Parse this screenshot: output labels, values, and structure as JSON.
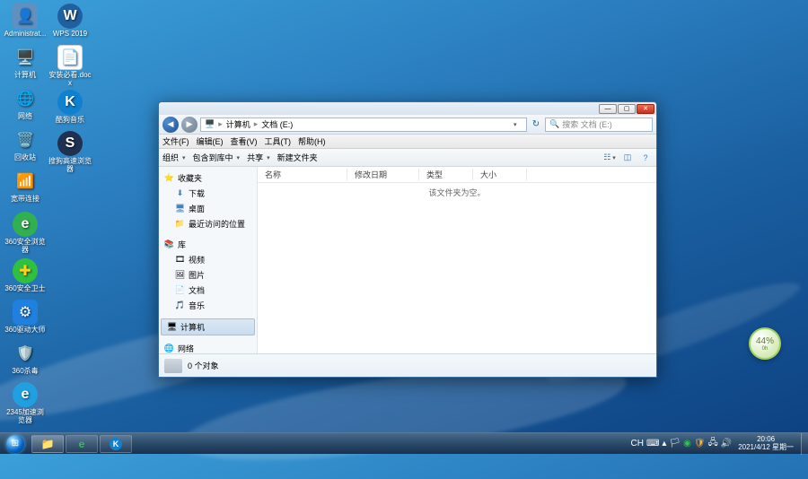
{
  "desktop_icons": {
    "c1": [
      {
        "label": "Administrat...",
        "icon": "👤",
        "bg": "#6090c0"
      },
      {
        "label": "计算机",
        "icon": "🖥",
        "bg": "transparent"
      },
      {
        "label": "网络",
        "icon": "🌐",
        "bg": "#4070a0"
      },
      {
        "label": "回收站",
        "icon": "🗑",
        "bg": "transparent"
      },
      {
        "label": "宽带连接",
        "icon": "🔌",
        "bg": "transparent"
      },
      {
        "label": "360安全浏览器",
        "icon": "e",
        "bg": "#30b050",
        "style": "color:#fff;font-weight:bold"
      },
      {
        "label": "360安全卫士",
        "icon": "●",
        "bg": "#30c040",
        "style": "color:#ffd020"
      },
      {
        "label": "360驱动大师",
        "icon": "⚙",
        "bg": "#2080e0",
        "style": "color:#fff"
      },
      {
        "label": "360杀毒",
        "icon": "🛡",
        "bg": "#208040",
        "style": "color:#8f8"
      },
      {
        "label": "2345加速浏览器",
        "icon": "e",
        "bg": "#20a0e0",
        "style": "color:#fff;font-weight:bold"
      }
    ],
    "c2": [
      {
        "label": "WPS 2019",
        "icon": "W",
        "bg": "#2060a0",
        "style": "color:#fff;font-weight:bold;border-radius:50%"
      },
      {
        "label": "安装必看.docx",
        "icon": "📄",
        "bg": "#fff",
        "style": "color:#2060a0"
      },
      {
        "label": "酷狗音乐",
        "icon": "K",
        "bg": "#1080d0",
        "style": "color:#fff;font-weight:bold;border-radius:50%"
      },
      {
        "label": "搜狗高速浏览器",
        "icon": "S",
        "bg": "#203050",
        "style": "color:#fff;font-weight:bold;border-radius:50%"
      }
    ]
  },
  "window": {
    "breadcrumb": [
      "计算机",
      "文档 (E:)"
    ],
    "search_placeholder": "搜索 文档 (E:)",
    "menus": [
      "文件(F)",
      "编辑(E)",
      "查看(V)",
      "工具(T)",
      "帮助(H)"
    ],
    "toolbar": {
      "organize": "组织",
      "include": "包含到库中",
      "share": "共享",
      "newfolder": "新建文件夹"
    },
    "sidebar": {
      "favorites": {
        "hdr": "收藏夹",
        "items": [
          "下载",
          "桌面",
          "最近访问的位置"
        ]
      },
      "libraries": {
        "hdr": "库",
        "items": [
          "视频",
          "图片",
          "文档",
          "音乐"
        ]
      },
      "computer": {
        "hdr": "计算机"
      },
      "network": {
        "hdr": "网络"
      }
    },
    "columns": [
      "名称",
      "修改日期",
      "类型",
      "大小"
    ],
    "empty_msg": "该文件夹为空。",
    "status": "0 个对象"
  },
  "battery": {
    "pct": "44%",
    "sub": "0h"
  },
  "tray": {
    "lang": "CH",
    "time": "20:06",
    "date": "2021/4/12 星期一"
  }
}
